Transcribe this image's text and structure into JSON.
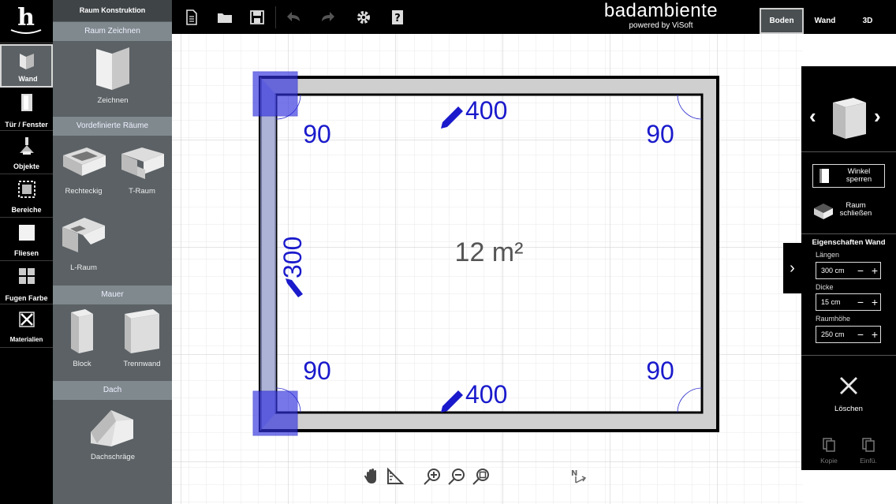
{
  "left_tools": [
    {
      "label": "Wand",
      "icon": "wall-icon",
      "active": true
    },
    {
      "label": "Tür / Fenster",
      "icon": "door-icon"
    },
    {
      "label": "Objekte",
      "icon": "objects-icon"
    },
    {
      "label": "Bereiche",
      "icon": "areas-icon"
    },
    {
      "label": "Fliesen",
      "icon": "tiles-icon"
    },
    {
      "label": "Fugen Farbe",
      "icon": "grout-icon"
    },
    {
      "label": "Materialien",
      "icon": "materials-icon"
    }
  ],
  "catalog": {
    "title": "Raum Konstruktion",
    "sections": [
      "Raum Zeichnen",
      "Vordefinierte Räume",
      "Mauer",
      "Dach"
    ],
    "items": {
      "draw": "Zeichnen",
      "rect": "Rechteckig",
      "t_room": "T-Raum",
      "l_room": "L-Raum",
      "block": "Block",
      "partition": "Trennwand",
      "roof": "Dachschräge"
    }
  },
  "brand": {
    "name": "badambiente",
    "sub": "powered by ViSoft"
  },
  "view_tabs": [
    "Boden",
    "Wand",
    "3D"
  ],
  "active_view": "Boden",
  "plan": {
    "area": "12 m²",
    "top_length": "400",
    "bottom_length": "400",
    "left_length": "300",
    "angles": [
      "90",
      "90",
      "90",
      "90"
    ]
  },
  "right_panel": {
    "lock_angle": "Winkel sperren",
    "close_room": "Raum schließen",
    "props_title": "Eigenschaften Wand",
    "length_label": "Längen",
    "length_value": "300 cm",
    "thickness_label": "Dicke",
    "thickness_value": "15 cm",
    "height_label": "Raumhöhe",
    "height_value": "250 cm",
    "delete": "Löschen",
    "copy": "Kopie",
    "paste": "Einfü."
  },
  "colors": {
    "accent": "#1a1acc",
    "panel": "#5b6165",
    "section": "#808a8e",
    "grid": "#d6d6d6"
  }
}
